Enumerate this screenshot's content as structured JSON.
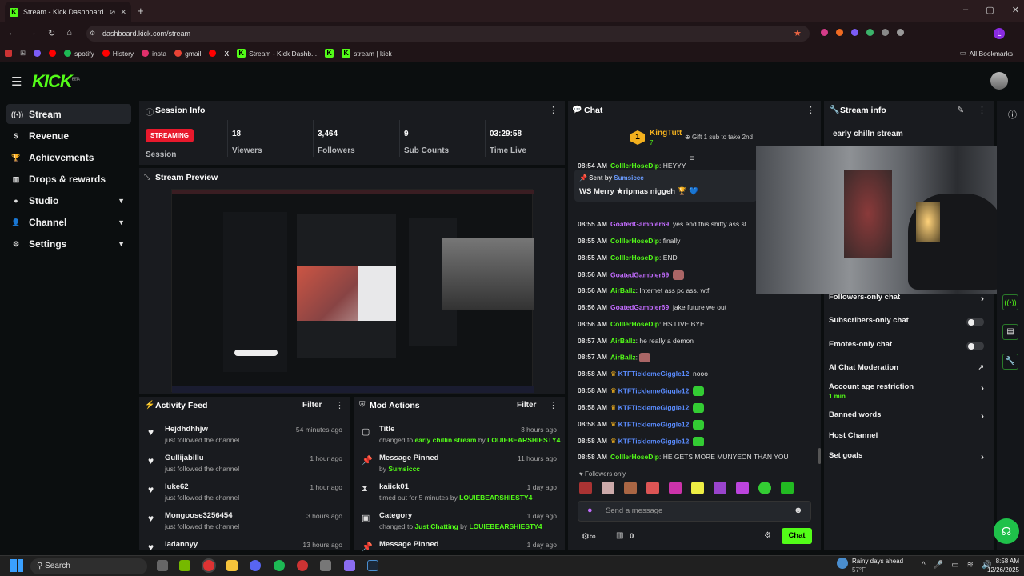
{
  "browser": {
    "tab_title": "Stream - Kick Dashboard",
    "url": "dashboard.kick.com/stream",
    "bookmarks": [
      "spotify",
      "History",
      "insta",
      "gmail",
      "Stream - Kick Dashb...",
      "stream | kick"
    ],
    "all_bookmarks": "All Bookmarks"
  },
  "app": {
    "logo": "KICK",
    "logo_sup": "BETA"
  },
  "nav": [
    {
      "label": "Stream",
      "icon": "stream-icon"
    },
    {
      "label": "Revenue",
      "icon": "revenue-icon"
    },
    {
      "label": "Achievements",
      "icon": "trophy-icon"
    },
    {
      "label": "Drops & rewards",
      "icon": "gift-icon"
    },
    {
      "label": "Studio",
      "icon": "studio-icon"
    },
    {
      "label": "Channel",
      "icon": "user-icon"
    },
    {
      "label": "Settings",
      "icon": "gear-icon"
    }
  ],
  "session": {
    "title": "Session Info",
    "status": "STREAMING",
    "status_label": "Session",
    "stats": [
      {
        "value": "18",
        "label": "Viewers"
      },
      {
        "value": "3,464",
        "label": "Followers"
      },
      {
        "value": "9",
        "label": "Sub Counts"
      },
      {
        "value": "03:29:58",
        "label": "Time Live"
      }
    ]
  },
  "preview": {
    "title": "Stream Preview"
  },
  "activity": {
    "title": "Activity Feed",
    "filter": "Filter",
    "items": [
      {
        "name": "Hejdhdhhjw",
        "sub": "just followed the channel",
        "time": "54 minutes ago"
      },
      {
        "name": "Gullijabillu",
        "sub": "just followed the channel",
        "time": "1 hour ago"
      },
      {
        "name": "luke62",
        "sub": "just followed the channel",
        "time": "1 hour ago"
      },
      {
        "name": "Mongoose3256454",
        "sub": "just followed the channel",
        "time": "3 hours ago"
      },
      {
        "name": "ladannyy",
        "sub": "",
        "time": "13 hours ago"
      }
    ]
  },
  "mod": {
    "title": "Mod Actions",
    "filter": "Filter",
    "items": [
      {
        "name": "Title",
        "pre": "changed to ",
        "hl": "early chillin stream",
        "mid": " by ",
        "by": "LOUIEBEARSHIESTY4",
        "time": "3 hours ago"
      },
      {
        "name": "Message Pinned",
        "pre": "by ",
        "hl": "",
        "mid": "",
        "by": "Sumsiccc",
        "time": "11 hours ago"
      },
      {
        "name": "kaiick01",
        "pre": "timed out for 5 minutes by ",
        "hl": "",
        "mid": "",
        "by": "LOUIEBEARSHIESTY4",
        "time": "1 day ago"
      },
      {
        "name": "Category",
        "pre": "changed to ",
        "hl": "Just Chatting",
        "mid": " by ",
        "by": "LOUIEBEARSHIESTY4",
        "time": "1 day ago"
      },
      {
        "name": "Message Pinned",
        "pre": "",
        "hl": "",
        "mid": "",
        "by": "",
        "time": "1 day ago"
      }
    ]
  },
  "chat": {
    "title": "Chat",
    "top_user": "KingTutt",
    "top_rank": "1",
    "top_count": "7",
    "gift_text": "Gift 1 sub to take 2nd",
    "pinned_by_label": "Sent by",
    "pinned_by": "Sumsiccc",
    "pinned_msg": "WS Merry ★ripmas niggeh",
    "messages": [
      {
        "t": "08:54 AM",
        "u": "ColllerHoseDip",
        "c": "#53fc18",
        "m": "HEYYY"
      },
      {
        "t": "08:55 AM",
        "u": "GoatedGambler69",
        "c": "#c36cff",
        "m": "yes end this shitty ass st"
      },
      {
        "t": "08:55 AM",
        "u": "ColllerHoseDip",
        "c": "#53fc18",
        "m": "finally"
      },
      {
        "t": "08:55 AM",
        "u": "ColllerHoseDip",
        "c": "#53fc18",
        "m": "END"
      },
      {
        "t": "08:56 AM",
        "u": "GoatedGambler69",
        "c": "#c36cff",
        "m": ""
      },
      {
        "t": "08:56 AM",
        "u": "AirBallz",
        "c": "#53fc18",
        "m": "Internet ass pc ass. wtf"
      },
      {
        "t": "08:56 AM",
        "u": "GoatedGambler69",
        "c": "#c36cff",
        "m": "jake future we out"
      },
      {
        "t": "08:56 AM",
        "u": "ColllerHoseDip",
        "c": "#53fc18",
        "m": "HS LIVE BYE"
      },
      {
        "t": "08:57 AM",
        "u": "AirBallz",
        "c": "#53fc18",
        "m": "he really a demon"
      },
      {
        "t": "08:57 AM",
        "u": "AirBallz",
        "c": "#53fc18",
        "m": ""
      },
      {
        "t": "08:58 AM",
        "u": "KTFTicklemeGiggle12",
        "c": "#5a8cff",
        "m": "nooo"
      },
      {
        "t": "08:58 AM",
        "u": "KTFTicklemeGiggle12",
        "c": "#5a8cff",
        "m": ""
      },
      {
        "t": "08:58 AM",
        "u": "KTFTicklemeGiggle12",
        "c": "#5a8cff",
        "m": ""
      },
      {
        "t": "08:58 AM",
        "u": "KTFTicklemeGiggle12",
        "c": "#5a8cff",
        "m": ""
      },
      {
        "t": "08:58 AM",
        "u": "KTFTicklemeGiggle12",
        "c": "#5a8cff",
        "m": ""
      },
      {
        "t": "08:58 AM",
        "u": "ColllerHoseDip",
        "c": "#53fc18",
        "m": "HE GETS MORE MUNYEON THAN YOU"
      }
    ],
    "followers_only": "Followers only",
    "placeholder": "Send a message",
    "count": "0",
    "send": "Chat"
  },
  "streaminfo": {
    "title": "Stream info",
    "stream_title": "early chilln stream",
    "settings": [
      {
        "label": "Followers-only chat",
        "kind": "chev",
        "sub": ""
      },
      {
        "label": "Subscribers-only chat",
        "kind": "toggle",
        "sub": ""
      },
      {
        "label": "Emotes-only chat",
        "kind": "toggle",
        "sub": ""
      },
      {
        "label": "AI Chat Moderation",
        "kind": "ext",
        "sub": ""
      },
      {
        "label": "Account age restriction",
        "kind": "chev",
        "sub": "1 min"
      },
      {
        "label": "Banned words",
        "kind": "chev",
        "sub": ""
      },
      {
        "label": "Host Channel",
        "kind": "none",
        "sub": ""
      },
      {
        "label": "Set goals",
        "kind": "chev",
        "sub": ""
      }
    ]
  },
  "taskbar": {
    "search": "Search",
    "weather": "Rainy days ahead",
    "temp": "57°F",
    "time": "8:58 AM",
    "date": "12/26/2025"
  },
  "colors": {
    "accent": "#53fc18",
    "panel": "#191b1f",
    "bg": "#0b0e0f",
    "streaming": "#e8192c"
  }
}
